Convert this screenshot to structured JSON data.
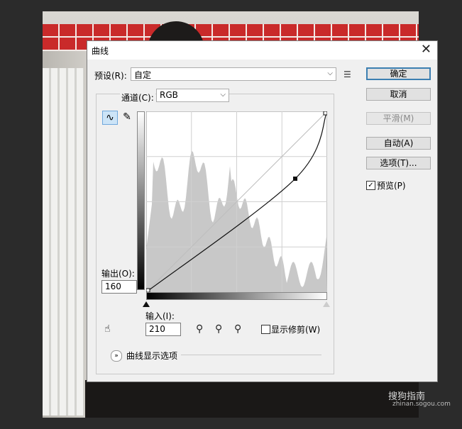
{
  "dialog": {
    "title": "曲线",
    "close_glyph": "✕",
    "preset_label": "预设(R):",
    "preset_value": "自定",
    "preset_menu_icon": "list-menu-icon",
    "channel_label": "通道(C):",
    "channel_value": "RGB",
    "output_label": "输出(O):",
    "output_value": "160",
    "input_label": "输入(I):",
    "input_value": "210",
    "show_clipping_label": "显示修剪(W)",
    "show_clipping_checked": false,
    "curve_display_options_label": "曲线显示选项"
  },
  "buttons": {
    "ok": "确定",
    "cancel": "取消",
    "smooth": "平滑(M)",
    "auto": "自动(A)",
    "options": "选项(T)..."
  },
  "preview": {
    "label": "预览(P)",
    "checked": true
  },
  "curve": {
    "points": [
      [
        0,
        0
      ],
      [
        210,
        160
      ],
      [
        255,
        255
      ]
    ]
  },
  "watermark": {
    "brand": "搜狗指南",
    "url": "zhinan.sogou.com"
  },
  "colors": {
    "primary_border": "#3c7fb1",
    "histogram": "#c8c8c8",
    "tool_active": "#cce4f7"
  }
}
